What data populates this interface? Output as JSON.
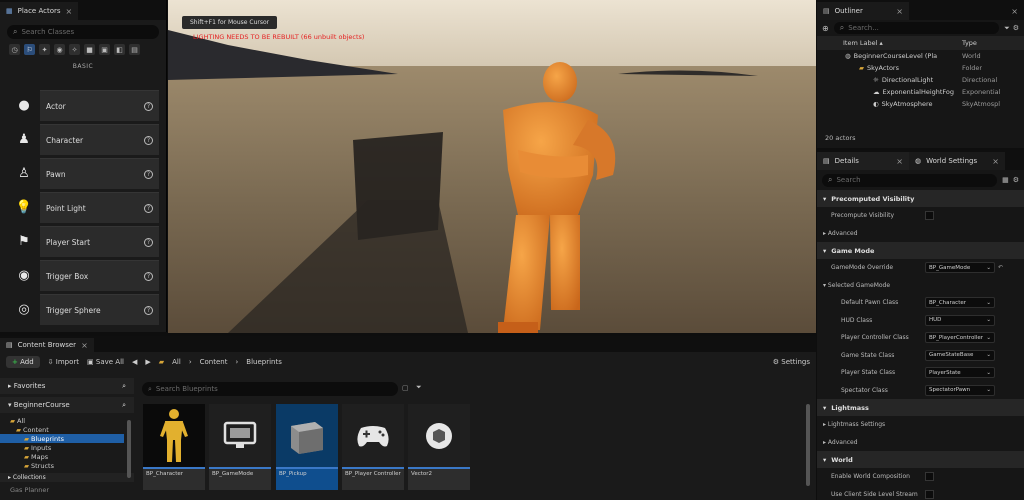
{
  "place_actors": {
    "tab_label": "Place Actors",
    "search_placeholder": "Search Classes",
    "section_label": "BASIC",
    "items": [
      {
        "label": "Actor",
        "icon": "sphere-icon"
      },
      {
        "label": "Character",
        "icon": "character-icon"
      },
      {
        "label": "Pawn",
        "icon": "pawn-icon"
      },
      {
        "label": "Point Light",
        "icon": "light-bulb-icon"
      },
      {
        "label": "Player Start",
        "icon": "player-start-icon"
      },
      {
        "label": "Trigger Box",
        "icon": "trigger-box-icon"
      },
      {
        "label": "Trigger Sphere",
        "icon": "trigger-sphere-icon"
      }
    ]
  },
  "viewport": {
    "hint": "Shift+F1 for Mouse Cursor",
    "warning": "LIGHTING NEEDS TO BE REBUILT (66 unbuilt objects)"
  },
  "outliner": {
    "tab_label": "Outliner",
    "search_placeholder": "Search...",
    "col_label": "Item Label",
    "col_type": "Type",
    "rows": [
      {
        "label": "BeginnerCourseLevel (Pla",
        "type": "World",
        "indent": 0
      },
      {
        "label": "SkyActors",
        "type": "Folder",
        "indent": 1
      },
      {
        "label": "DirectionalLight",
        "type": "Directional",
        "indent": 2
      },
      {
        "label": "ExponentialHeightFog",
        "type": "Exponential",
        "indent": 2
      },
      {
        "label": "SkyAtmosphere",
        "type": "SkyAtmospl",
        "indent": 2
      }
    ],
    "count": "20 actors"
  },
  "details": {
    "tab_details": "Details",
    "tab_world_settings": "World Settings",
    "search_placeholder": "Search",
    "sections": [
      {
        "label": "Precomputed Visibility",
        "kind": "section"
      },
      {
        "label": "Precompute Visibility",
        "kind": "check"
      },
      {
        "label": "Advanced",
        "kind": "sub"
      },
      {
        "label": "Game Mode",
        "kind": "section"
      },
      {
        "label": "GameMode Override",
        "kind": "dropdown",
        "value": "BP_GameMode"
      },
      {
        "label": "Selected GameMode",
        "kind": "sub"
      },
      {
        "label": "Default Pawn Class",
        "kind": "dropdown-deep",
        "value": "BP_Character"
      },
      {
        "label": "HUD Class",
        "kind": "dropdown-deep",
        "value": "HUD"
      },
      {
        "label": "Player Controller Class",
        "kind": "dropdown-deep",
        "value": "BP_PlayerController"
      },
      {
        "label": "Game State Class",
        "kind": "dropdown-deep",
        "value": "GameStateBase"
      },
      {
        "label": "Player State Class",
        "kind": "dropdown-deep",
        "value": "PlayerState"
      },
      {
        "label": "Spectator Class",
        "kind": "dropdown-deep",
        "value": "SpectatorPawn"
      },
      {
        "label": "Lightmass",
        "kind": "section"
      },
      {
        "label": "Lightmass Settings",
        "kind": "sub"
      },
      {
        "label": "Advanced",
        "kind": "sub"
      },
      {
        "label": "World",
        "kind": "section"
      },
      {
        "label": "Enable World Composition",
        "kind": "check"
      },
      {
        "label": "Use Client Side Level Stream",
        "kind": "check"
      }
    ]
  },
  "content_browser": {
    "tab_label": "Content Browser",
    "add_label": "Add",
    "import_label": "Import",
    "save_all_label": "Save All",
    "breadcrumbs": [
      "All",
      "Content",
      "Blueprints"
    ],
    "settings_label": "Settings",
    "favorites_label": "Favorites",
    "project_label": "BeginnerCourse",
    "search_placeholder": "Search Blueprints",
    "folders": [
      {
        "label": "All",
        "indent": 0,
        "selected": false
      },
      {
        "label": "Content",
        "indent": 1,
        "selected": false
      },
      {
        "label": "Blueprints",
        "indent": 2,
        "selected": true
      },
      {
        "label": "Inputs",
        "indent": 2,
        "selected": false
      },
      {
        "label": "Maps",
        "indent": 2,
        "selected": false
      },
      {
        "label": "Structs",
        "indent": 2,
        "selected": false
      }
    ],
    "bottom_sections": [
      "Collections",
      "Gas Planner"
    ],
    "assets": [
      {
        "label": "BP_Character",
        "icon": "character-mannequin-icon",
        "selected": false
      },
      {
        "label": "BP_GameMode",
        "icon": "monitor-icon",
        "selected": false
      },
      {
        "label": "BP_Pickup",
        "icon": "cube-icon",
        "selected": true
      },
      {
        "label": "BP_Player Controller",
        "icon": "gamepad-icon",
        "selected": false
      },
      {
        "label": "Vector2",
        "icon": "struct-icon",
        "selected": false
      }
    ]
  },
  "colors": {
    "accent_blue": "#1f5fa6",
    "warning_red": "#e52222",
    "mannequin_orange": "#e8862a",
    "folder_yellow": "#d7a538",
    "add_green": "#38b24a"
  }
}
